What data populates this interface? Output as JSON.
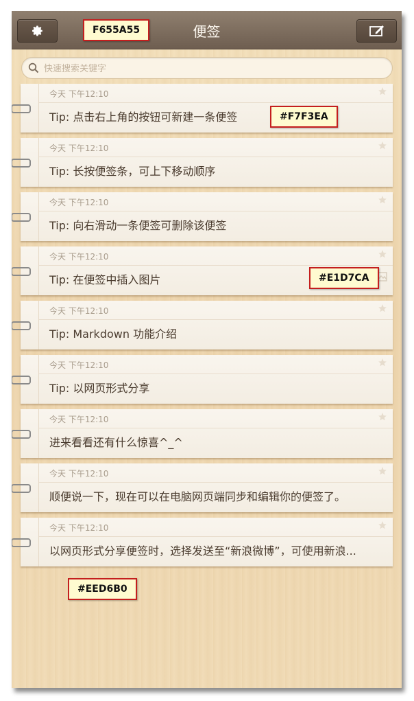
{
  "header": {
    "title": "便签",
    "settings_icon": "gear-icon",
    "compose_icon": "compose-icon"
  },
  "search": {
    "placeholder": "快速搜索关键字",
    "value": ""
  },
  "notes": [
    {
      "date": "今天  下午12:10",
      "text": "Tip: 点击右上角的按钮可新建一条便签"
    },
    {
      "date": "今天  下午12:10",
      "text": "Tip: 长按便签条，可上下移动顺序"
    },
    {
      "date": "今天  下午12:10",
      "text": "Tip: 向右滑动一条便签可删除该便签"
    },
    {
      "date": "今天  下午12:10",
      "text": "Tip: 在便签中插入图片"
    },
    {
      "date": "今天  下午12:10",
      "text": "Tip: Markdown 功能介绍"
    },
    {
      "date": "今天  下午12:10",
      "text": "Tip: 以网页形式分享"
    },
    {
      "date": "今天  下午12:10",
      "text": "进来看看还有什么惊喜^_^"
    },
    {
      "date": "今天  下午12:10",
      "text": "顺便说一下，现在可以在电脑网页端同步和编辑你的便签了。"
    },
    {
      "date": "今天  下午12:10",
      "text": "以网页形式分享便签时，选择发送至“新浪微博”，可使用新浪..."
    }
  ],
  "color_annotations": {
    "header": "F655A55",
    "note": "#F7F3EA",
    "note_alt": "#E1D7CA",
    "background": "#EED6B0"
  }
}
